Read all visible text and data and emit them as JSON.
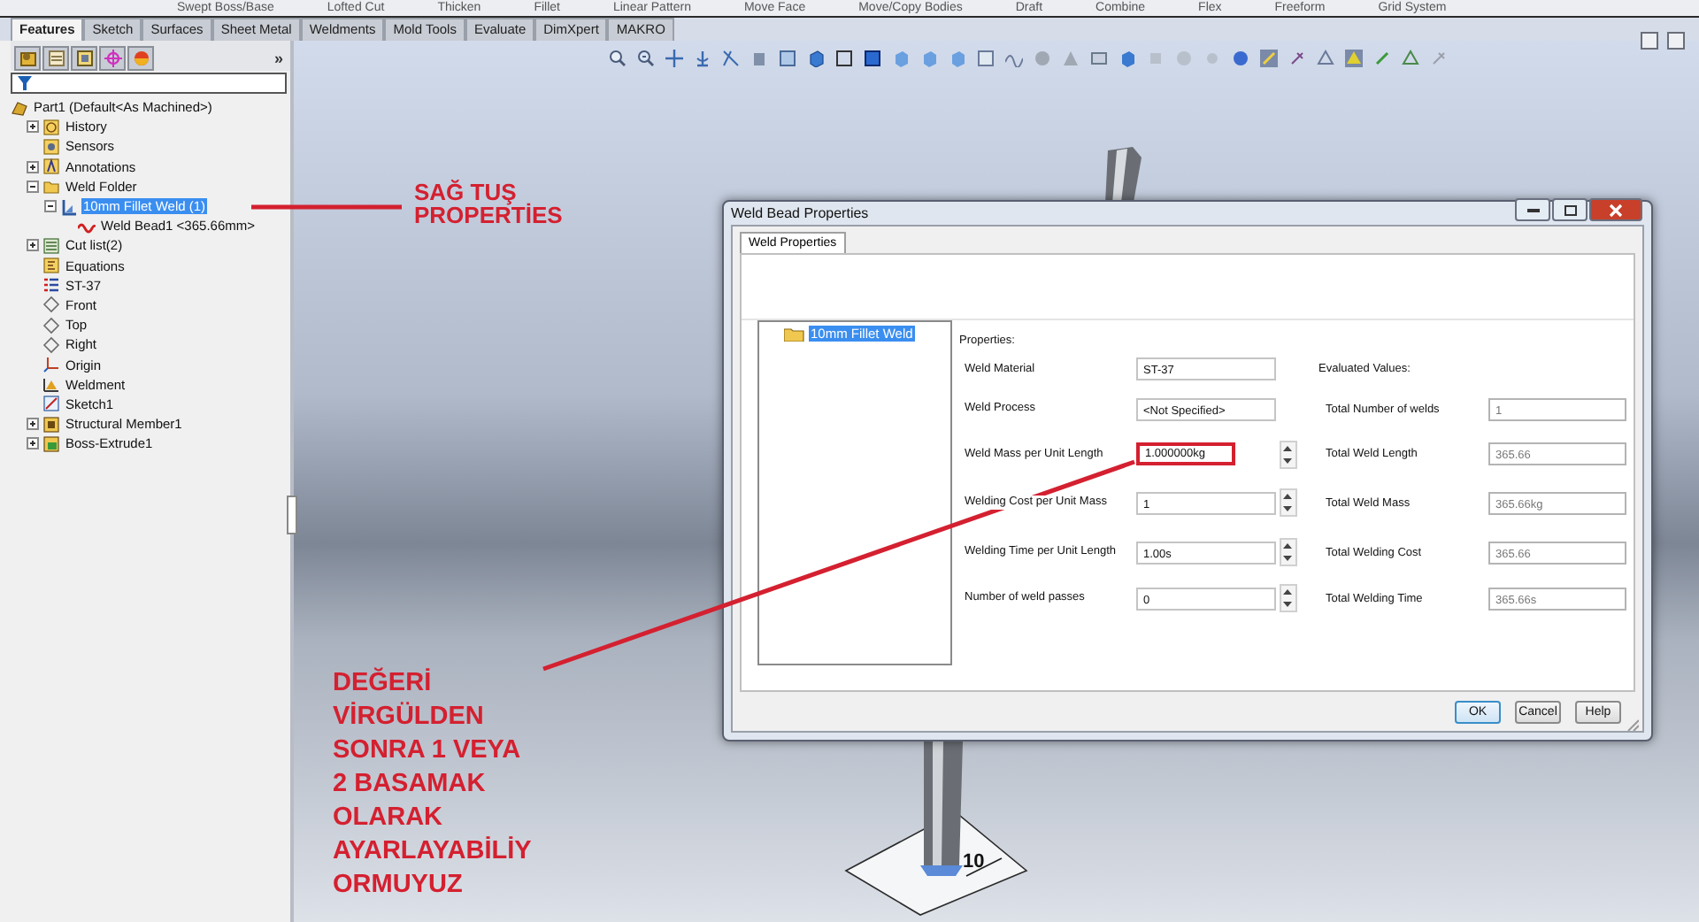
{
  "command_bar": {
    "items": [
      "Swept Boss/Base",
      "Lofted Cut",
      "Thicken",
      "Fillet",
      "Linear Pattern",
      "Move Face",
      "Move/Copy Bodies",
      "Draft",
      "Combine",
      "Flex",
      "Freeform",
      "Grid System"
    ]
  },
  "tabs": [
    {
      "label": "Features",
      "selected": true
    },
    {
      "label": "Sketch",
      "selected": false
    },
    {
      "label": "Surfaces",
      "selected": false
    },
    {
      "label": "Sheet Metal",
      "selected": false
    },
    {
      "label": "Weldments",
      "selected": false
    },
    {
      "label": "Mold Tools",
      "selected": false
    },
    {
      "label": "Evaluate",
      "selected": false
    },
    {
      "label": "DimXpert",
      "selected": false
    },
    {
      "label": "MAKRO",
      "selected": false
    }
  ],
  "feature_manager": {
    "more": "»",
    "tree": [
      {
        "kind": "part",
        "label": "Part1  (Default<As Machined>)",
        "expandable": false,
        "selected": false,
        "children": [
          {
            "kind": "history",
            "label": "History",
            "expandable": true,
            "expanded": false,
            "selected": false
          },
          {
            "kind": "sensors",
            "label": "Sensors",
            "expandable": false,
            "selected": false
          },
          {
            "kind": "annotations",
            "label": "Annotations",
            "expandable": true,
            "expanded": false,
            "selected": false
          },
          {
            "kind": "folder",
            "label": "Weld Folder",
            "expandable": true,
            "expanded": true,
            "selected": false,
            "children": [
              {
                "kind": "weld",
                "label": "10mm Fillet Weld (1)",
                "expandable": true,
                "expanded": true,
                "selected": true,
                "children": [
                  {
                    "kind": "weld-bead",
                    "label": "Weld Bead1 <365.66mm>",
                    "expandable": false,
                    "selected": false
                  }
                ]
              }
            ]
          },
          {
            "kind": "cut-list",
            "label": "Cut list(2)",
            "expandable": true,
            "expanded": false,
            "selected": false
          },
          {
            "kind": "equations",
            "label": "Equations",
            "expandable": false,
            "selected": false
          },
          {
            "kind": "material",
            "label": "ST-37",
            "expandable": false,
            "selected": false
          },
          {
            "kind": "plane",
            "label": "Front",
            "expandable": false,
            "selected": false
          },
          {
            "kind": "plane",
            "label": "Top",
            "expandable": false,
            "selected": false
          },
          {
            "kind": "plane",
            "label": "Right",
            "expandable": false,
            "selected": false
          },
          {
            "kind": "origin",
            "label": "Origin",
            "expandable": false,
            "selected": false
          },
          {
            "kind": "weldment",
            "label": "Weldment",
            "expandable": false,
            "selected": false
          },
          {
            "kind": "sketch",
            "label": "Sketch1",
            "expandable": false,
            "selected": false
          },
          {
            "kind": "structural",
            "label": "Structural Member1",
            "expandable": true,
            "expanded": false,
            "selected": false
          },
          {
            "kind": "extrude",
            "label": "Boss-Extrude1",
            "expandable": true,
            "expanded": false,
            "selected": false
          }
        ]
      }
    ]
  },
  "dialog": {
    "title": "Weld Bead Properties",
    "tabs": [
      {
        "label": "Weld Properties",
        "selected": true
      }
    ],
    "tree": [
      {
        "label": "10mm Fillet Weld",
        "selected": true
      }
    ],
    "properties_heading": "Properties:",
    "properties": [
      {
        "label": "Weld Material",
        "value": "ST-37",
        "spinner": false,
        "highlighted": false
      },
      {
        "label": "Weld Process",
        "value": "<Not Specified>",
        "spinner": false,
        "highlighted": false
      },
      {
        "label": "Weld Mass per Unit Length",
        "value": "1.000000kg",
        "spinner": true,
        "highlighted": true
      },
      {
        "label": "Welding Cost per Unit Mass",
        "value": "1",
        "spinner": true,
        "highlighted": false
      },
      {
        "label": "Welding Time per Unit Length",
        "value": "1.00s",
        "spinner": true,
        "highlighted": false
      },
      {
        "label": "Number of weld passes",
        "value": "0",
        "spinner": true,
        "highlighted": false
      }
    ],
    "evaluated_heading": "Evaluated Values:",
    "evaluated": [
      {
        "label": "Total Number of welds",
        "value": "1"
      },
      {
        "label": "Total Weld Length",
        "value": "365.66"
      },
      {
        "label": "Total Weld Mass",
        "value": "365.66kg"
      },
      {
        "label": "Total Welding Cost",
        "value": "365.66"
      },
      {
        "label": "Total Welding Time",
        "value": "365.66s"
      }
    ],
    "buttons": [
      {
        "label": "OK",
        "default": true
      },
      {
        "label": "Cancel",
        "default": false
      },
      {
        "label": "Help",
        "default": false
      }
    ]
  },
  "model": {
    "dimension_label": "10"
  },
  "annotations": [
    {
      "text": "SAĞ TUŞ\nPROPERTİES"
    },
    {
      "text": "DEĞERİ\nVİRGÜLDEN\nSONRA 1 VEYA\n2 BASAMAK\nOLARAK\nAYARLAYABİLİY\nORMUYUZ"
    }
  ]
}
